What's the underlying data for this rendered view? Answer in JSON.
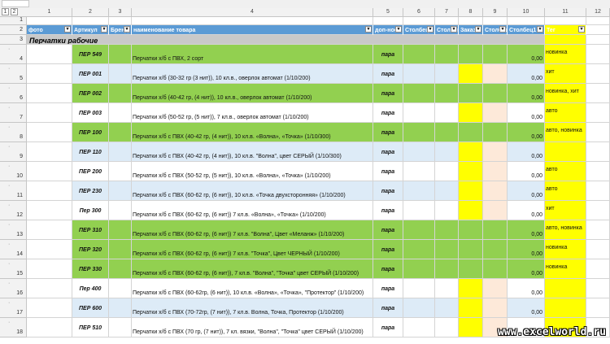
{
  "sheet": {
    "outline_levels": [
      "1",
      "2"
    ],
    "column_numbers": [
      "1",
      "2",
      "3",
      "4",
      "5",
      "6",
      "7",
      "8",
      "9",
      "10",
      "11",
      "12"
    ],
    "header": {
      "row_number": "2",
      "columns": [
        "фото",
        "Артикул",
        "Бренд",
        "наименование товара",
        "доп-ное",
        "Столбец",
        "Столбец",
        "Заказ",
        "Столбец",
        "Столбец1",
        "Тег",
        ""
      ]
    },
    "category": {
      "row_number": "3",
      "label": "Перчатки рабочие"
    },
    "colors": {
      "header_blue": "#5b9bd5",
      "green_row": "#92d050",
      "blue_row": "#ddebf7",
      "yellow": "#ffff00",
      "cream": "#fde9d9",
      "category_gray": "#c9c9c9"
    },
    "rows": [
      {
        "row_number": "4",
        "art": "ПЕР 549",
        "desc": "Перчатки х/б с ПВХ, 2 сорт",
        "unit": "пара",
        "price": "0,00",
        "tag": "новинка",
        "style": "green"
      },
      {
        "row_number": "5",
        "art": "ПЕР 001",
        "desc": "Перчатки х/б (30-32 гр (3 нит)), 10 кл.в., оверлок автомат (1/10/200)",
        "unit": "пара",
        "price": "0,00",
        "tag": "хит",
        "style": "blue"
      },
      {
        "row_number": "6",
        "art": "ПЕР 002",
        "desc": "Перчатки х/б (40-42 гр, (4 нит)), 10 кл.в., оверлок автомат (1/10/200)",
        "unit": "пара",
        "price": "0,00",
        "tag": "новинка, хит",
        "style": "green"
      },
      {
        "row_number": "7",
        "art": "ПЕР 003",
        "desc": "Перчатки х/б (50-52 гр, (5 нит)), 7 кл.в., оверлок автомат (1/10/200)",
        "unit": "пара",
        "price": "0,00",
        "tag": "авто",
        "style": "white"
      },
      {
        "row_number": "8",
        "art": "ПЕР 100",
        "desc": "Перчатки х/б с ПВХ (40-42 гр, (4 нит)), 10 кл.в. «Волна», «Точка» (1/10/300)",
        "unit": "пара",
        "price": "0,00",
        "tag": "авто, новинка",
        "style": "green"
      },
      {
        "row_number": "9",
        "art": "ПЕР 110",
        "desc": "Перчатки х/б с ПВХ (40-42 гр, (4 нит)), 10 кл.в. \"Волна\", цвет СЕРЫЙ (1/10/300)",
        "unit": "пара",
        "price": "0,00",
        "tag": "",
        "style": "blue"
      },
      {
        "row_number": "10",
        "art": "ПЕР 200",
        "desc": "Перчатки х/б с ПВХ (50-52 гр, (5 нит)), 10 кл.в. «Волна», «Точка» (1/10/200)",
        "unit": "пара",
        "price": "0,00",
        "tag": "авто",
        "style": "white"
      },
      {
        "row_number": "11",
        "art": "ПЕР 230",
        "desc": "Перчатки х/б с ПВХ (60-62 гр, (6 нит)), 10 кл.в. «Точка двухсторонняя» (1/10/200)",
        "unit": "пара",
        "price": "0,00",
        "tag": "авто",
        "style": "blue"
      },
      {
        "row_number": "12",
        "art": "Пер 300",
        "desc": "Перчатки х/б с ПВХ (60-62 гр, (6 нит)) 7 кл.в. «Волна», «Точка» (1/10/200)",
        "unit": "пара",
        "price": "0,00",
        "tag": "хит",
        "style": "white"
      },
      {
        "row_number": "13",
        "art": "ПЕР 310",
        "desc": "Перчатки х/б с ПВХ (60-62 гр, (6 нит)) 7 кл.в. \"Волна\", Цвет «Меланж» (1/10/200)",
        "unit": "пара",
        "price": "0,00",
        "tag": "авто, новинка",
        "style": "green"
      },
      {
        "row_number": "14",
        "art": "ПЕР 320",
        "desc": "Перчатки х/б с ПВХ (60-62 гр, (6 нит)) 7 кл.в. \"Точка\", Цвет ЧЕРНЫЙ (1/10/200)",
        "unit": "пара",
        "price": "0,00",
        "tag": "новинка",
        "style": "green"
      },
      {
        "row_number": "15",
        "art": "ПЕР 330",
        "desc": "Перчатки х/б с ПВХ (60-62 гр, (6 нит)), 7 кл.в. \"Волна\", \"Точка\" цвет СЕРЫЙ (1/10/200)",
        "unit": "пара",
        "price": "0,00",
        "tag": "новинка",
        "style": "green"
      },
      {
        "row_number": "16",
        "art": "Пер 400",
        "desc": "Перчатки х/б с ПВХ (60-62гр, (6 нит)), 10 кл.в. «Волна», «Точка», \"Протектор\" (1/10/200)",
        "unit": "пара",
        "price": "0,00",
        "tag": "",
        "style": "white"
      },
      {
        "row_number": "17",
        "art": "ПЕР 600",
        "desc": "Перчатки х/б с ПВХ (70-72гр, (7 нит)), 7 кл.в. Волна, Точка, Протектор (1/10/200)",
        "unit": "пара",
        "price": "0,00",
        "tag": "",
        "style": "blue"
      },
      {
        "row_number": "18",
        "art": "ПЕР 510",
        "desc": "Перчатки х/б с ПВХ (70 гр, (7 нит)), 7 кл. вязки, \"Волна\", \"Точка\" цвет СЕРЫЙ (1/10/200)",
        "unit": "пара",
        "price": "0,00",
        "tag": "",
        "style": "white"
      }
    ],
    "watermark": "www.excelworld.ru"
  }
}
